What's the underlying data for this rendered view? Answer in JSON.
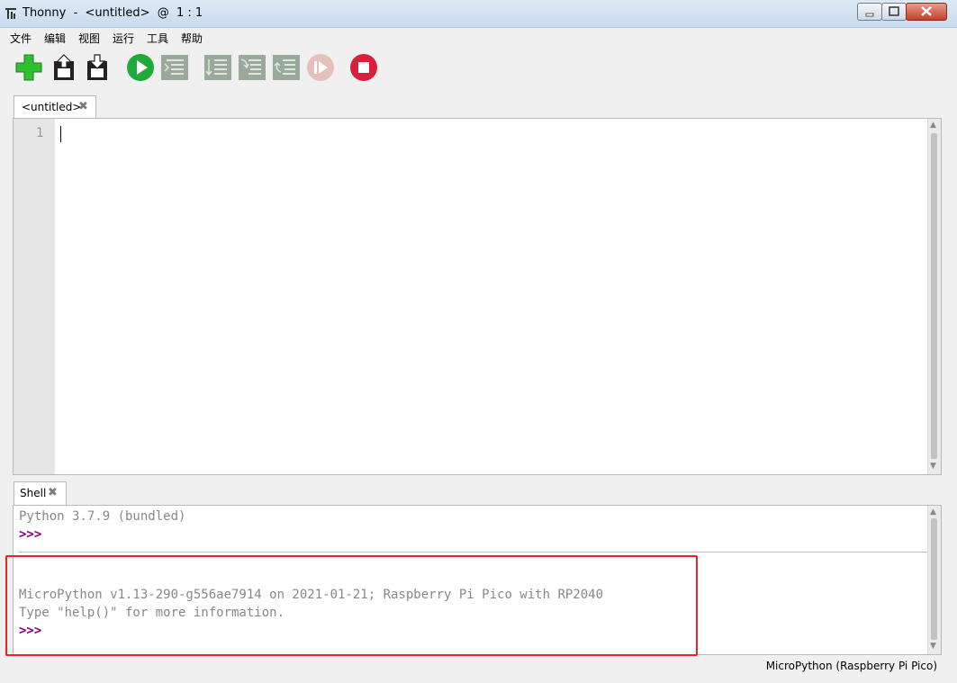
{
  "window": {
    "title": "Thonny  -  <untitled>  @  1 : 1"
  },
  "menu": {
    "items": [
      "文件",
      "编辑",
      "视图",
      "运行",
      "工具",
      "帮助"
    ]
  },
  "toolbar": {
    "icons": [
      "new-file-icon",
      "open-file-icon",
      "save-file-icon",
      "run-icon",
      "debug-icon",
      "step-over-icon",
      "step-into-icon",
      "step-out-icon",
      "resume-icon",
      "stop-icon"
    ]
  },
  "editor": {
    "tab_label": "<untitled>",
    "tab_close": "✖",
    "line_number": "1"
  },
  "shell": {
    "tab_label": "Shell",
    "tab_close": "✖",
    "lines": [
      "Python 3.7.9 (bundled)",
      ">>>",
      "MicroPython v1.13-290-g556ae7914 on 2021-01-21; Raspberry Pi Pico with RP2040",
      "Type \"help()\" for more information.",
      ">>>"
    ]
  },
  "status": {
    "interpreter": "MicroPython (Raspberry Pi Pico)"
  },
  "colors": {
    "prompt": "#800080",
    "highlight": "#e8262f",
    "run_green": "#1faa3b",
    "stop_red": "#d8203a"
  }
}
